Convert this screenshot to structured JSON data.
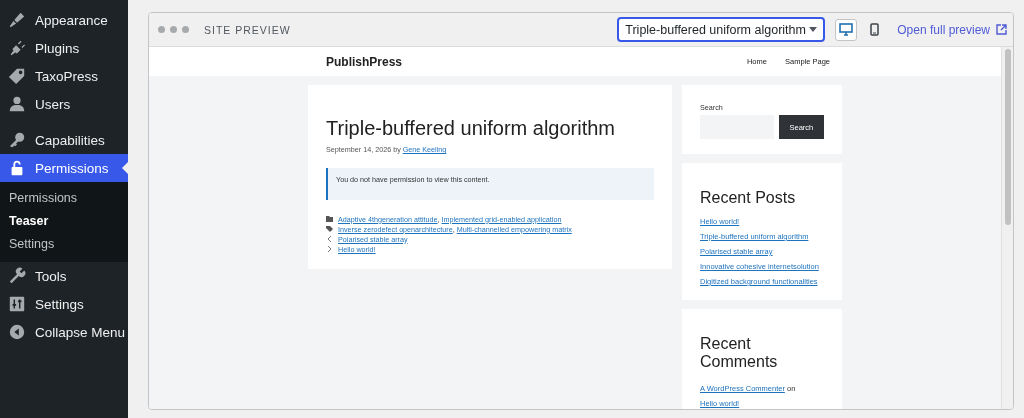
{
  "admin_menu": {
    "items": [
      {
        "label": "Appearance",
        "selected": false
      },
      {
        "label": "Plugins",
        "selected": false
      },
      {
        "label": "TaxoPress",
        "selected": false
      },
      {
        "label": "Users",
        "selected": false
      },
      {
        "label": "Capabilities",
        "selected": false
      },
      {
        "label": "Permissions",
        "selected": true,
        "children": [
          {
            "label": "Permissions",
            "selected": false
          },
          {
            "label": "Teaser",
            "selected": true
          },
          {
            "label": "Settings",
            "selected": false
          }
        ]
      },
      {
        "label": "Tools",
        "selected": false
      },
      {
        "label": "Settings",
        "selected": false
      },
      {
        "label": "Collapse Menu",
        "selected": false
      }
    ]
  },
  "preview": {
    "title": "SITE PREVIEW",
    "post_select": {
      "value": "Triple-buffered uniform algorithm"
    },
    "devices": [
      {
        "selected": true
      },
      {
        "selected": false
      }
    ],
    "open_link": "Open full preview",
    "site": {
      "brand": "PublishPress",
      "nav": [
        "Home",
        "Sample Page"
      ],
      "post": {
        "title": "Triple-buffered uniform algorithm",
        "date": "September 14, 2026 by",
        "author": "Gene Keeling",
        "notice": "You do not have permission to view this content.",
        "separator": ",",
        "categories": [
          "Adaptive 4thgeneration attitude",
          "Implemented grid-enabled application"
        ],
        "tags": [
          "Inverse zerodefect openarchitecture",
          "Multi-channelled empowering matrix"
        ],
        "previous": "Polarised stable array",
        "next": "Hello world!"
      },
      "search": {
        "label": "Search",
        "button": "Search"
      },
      "recent_posts": {
        "title": "Recent Posts",
        "items": [
          "Hello world!",
          "Triple-buffered uniform algorithm",
          "Polarised stable array",
          "Innovative cohesive internetsolution",
          "Digitized background functionalities"
        ]
      },
      "recent_comments": {
        "title": "Recent Comments",
        "author": "A WordPress Commenter",
        "joiner": "on",
        "post": "Hello world!"
      }
    }
  }
}
